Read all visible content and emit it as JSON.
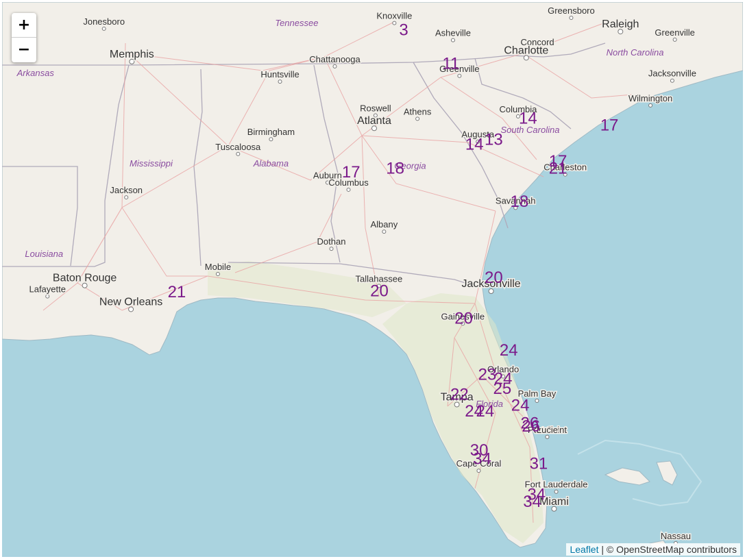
{
  "map": {
    "zoom_in_label": "+",
    "zoom_out_label": "−",
    "attribution": {
      "link_text": "Leaflet",
      "separator": " | © ",
      "text": "OpenStreetMap contributors"
    },
    "colors": {
      "water": "#aad3df",
      "land": "#f2efe9",
      "green_land": "#dfe8c9",
      "state_border": "#b0aaba",
      "road": "#e9a2a2",
      "marker_text": "#7b1a8a",
      "state_label": "#8a4ca0"
    },
    "cities": [
      {
        "name": "Jonesboro",
        "lat": 35.84,
        "lon": -90.7,
        "size": "small"
      },
      {
        "name": "Memphis",
        "lat": 35.15,
        "lon": -90.05,
        "size": "large"
      },
      {
        "name": "Knoxville",
        "lat": 35.96,
        "lon": -83.92,
        "size": "small"
      },
      {
        "name": "Greensboro",
        "lat": 36.07,
        "lon": -79.79,
        "size": "small"
      },
      {
        "name": "Raleigh",
        "lat": 35.78,
        "lon": -78.64,
        "size": "large"
      },
      {
        "name": "Asheville",
        "lat": 35.6,
        "lon": -82.55,
        "size": "small"
      },
      {
        "name": "Concord",
        "lat": 35.41,
        "lon": -80.58,
        "size": "small"
      },
      {
        "name": "Greenville",
        "lat": 35.61,
        "lon": -77.37,
        "size": "small"
      },
      {
        "name": "Chattanooga",
        "lat": 35.05,
        "lon": -85.31,
        "size": "small"
      },
      {
        "name": "Charlotte",
        "lat": 35.23,
        "lon": -80.84,
        "size": "large"
      },
      {
        "name": "Greenville",
        "lat": 34.85,
        "lon": -82.4,
        "size": "small"
      },
      {
        "name": "Huntsville",
        "lat": 34.73,
        "lon": -86.59,
        "size": "small"
      },
      {
        "name": "Jacksonville",
        "lat": 34.75,
        "lon": -77.43,
        "size": "small"
      },
      {
        "name": "Wilmington",
        "lat": 34.23,
        "lon": -77.94,
        "size": "small"
      },
      {
        "name": "Roswell",
        "lat": 34.02,
        "lon": -84.36,
        "size": "small"
      },
      {
        "name": "Athens",
        "lat": 33.95,
        "lon": -83.38,
        "size": "small"
      },
      {
        "name": "Columbia",
        "lat": 34.0,
        "lon": -81.03,
        "size": "small"
      },
      {
        "name": "Birmingham",
        "lat": 33.52,
        "lon": -86.8,
        "size": "small"
      },
      {
        "name": "Atlanta",
        "lat": 33.75,
        "lon": -84.39,
        "size": "large"
      },
      {
        "name": "Augusta",
        "lat": 33.47,
        "lon": -81.97,
        "size": "small"
      },
      {
        "name": "Tuscaloosa",
        "lat": 33.21,
        "lon": -87.57,
        "size": "small"
      },
      {
        "name": "Charleston",
        "lat": 32.78,
        "lon": -79.93,
        "size": "small"
      },
      {
        "name": "Auburn",
        "lat": 32.61,
        "lon": -85.48,
        "size": "small"
      },
      {
        "name": "Columbus",
        "lat": 32.46,
        "lon": -84.99,
        "size": "small"
      },
      {
        "name": "Jackson",
        "lat": 32.3,
        "lon": -90.18,
        "size": "small"
      },
      {
        "name": "Savannah",
        "lat": 32.08,
        "lon": -81.09,
        "size": "small"
      },
      {
        "name": "Albany",
        "lat": 31.58,
        "lon": -84.16,
        "size": "small"
      },
      {
        "name": "Dothan",
        "lat": 31.22,
        "lon": -85.39,
        "size": "small"
      },
      {
        "name": "Mobile",
        "lat": 30.69,
        "lon": -88.04,
        "size": "small"
      },
      {
        "name": "Baton Rouge",
        "lat": 30.45,
        "lon": -91.15,
        "size": "large"
      },
      {
        "name": "Tallahassee",
        "lat": 30.44,
        "lon": -84.28,
        "size": "small"
      },
      {
        "name": "Lafayette",
        "lat": 30.22,
        "lon": -92.02,
        "size": "small"
      },
      {
        "name": "New Orleans",
        "lat": 29.95,
        "lon": -90.07,
        "size": "large"
      },
      {
        "name": "Jacksonville",
        "lat": 30.33,
        "lon": -81.66,
        "size": "large"
      },
      {
        "name": "Gainesville",
        "lat": 29.65,
        "lon": -82.32,
        "size": "small"
      },
      {
        "name": "Orlando",
        "lat": 28.54,
        "lon": -81.38,
        "size": "small"
      },
      {
        "name": "Tampa",
        "lat": 27.95,
        "lon": -82.46,
        "size": "large"
      },
      {
        "name": "Palm Bay",
        "lat": 28.03,
        "lon": -80.59,
        "size": "small"
      },
      {
        "name": "Port Saint",
        "lat": 27.27,
        "lon": -80.35,
        "size": "small"
      },
      {
        "name": "Lucie",
        "lat": 27.27,
        "lon": -80.35,
        "size": "small"
      },
      {
        "name": "Cape Coral",
        "lat": 26.56,
        "lon": -81.95,
        "size": "small"
      },
      {
        "name": "Fort Lauderdale",
        "lat": 26.12,
        "lon": -80.14,
        "size": "small"
      },
      {
        "name": "Miami",
        "lat": 25.76,
        "lon": -80.19,
        "size": "large"
      },
      {
        "name": "Nassau",
        "lat": 25.04,
        "lon": -77.35,
        "size": "small"
      }
    ],
    "state_labels": [
      {
        "name": "Tennessee",
        "lat": 35.9,
        "lon": -86.2
      },
      {
        "name": "North Carolina",
        "lat": 35.28,
        "lon": -78.3
      },
      {
        "name": "Arkansas",
        "lat": 34.85,
        "lon": -92.3
      },
      {
        "name": "South Carolina",
        "lat": 33.65,
        "lon": -80.75
      },
      {
        "name": "Mississippi",
        "lat": 32.95,
        "lon": -89.6
      },
      {
        "name": "Alabama",
        "lat": 32.95,
        "lon": -86.8
      },
      {
        "name": "Georgia",
        "lat": 32.9,
        "lon": -83.55
      },
      {
        "name": "Louisiana",
        "lat": 31.05,
        "lon": -92.1
      },
      {
        "name": "Florida",
        "lat": 27.9,
        "lon": -81.7
      }
    ],
    "markers": [
      {
        "value": "3",
        "lat": 35.7,
        "lon": -83.7
      },
      {
        "value": "11",
        "lat": 35.0,
        "lon": -82.6
      },
      {
        "value": "14",
        "lat": 33.85,
        "lon": -80.8
      },
      {
        "value": "13",
        "lat": 33.4,
        "lon": -81.6
      },
      {
        "value": "14",
        "lat": 33.3,
        "lon": -82.05
      },
      {
        "value": "17",
        "lat": 33.7,
        "lon": -78.9
      },
      {
        "value": "17",
        "lat": 32.95,
        "lon": -80.1
      },
      {
        "value": "21",
        "lat": 32.8,
        "lon": -80.1
      },
      {
        "value": "17",
        "lat": 32.72,
        "lon": -84.93
      },
      {
        "value": "18",
        "lat": 32.8,
        "lon": -83.9
      },
      {
        "value": "18",
        "lat": 32.1,
        "lon": -81.0
      },
      {
        "value": "21",
        "lat": 30.2,
        "lon": -89.0
      },
      {
        "value": "20",
        "lat": 30.22,
        "lon": -84.27
      },
      {
        "value": "20",
        "lat": 30.5,
        "lon": -81.6
      },
      {
        "value": "20",
        "lat": 29.65,
        "lon": -82.3
      },
      {
        "value": "24",
        "lat": 28.98,
        "lon": -81.25
      },
      {
        "value": "23",
        "lat": 28.47,
        "lon": -81.75
      },
      {
        "value": "24",
        "lat": 28.38,
        "lon": -81.38
      },
      {
        "value": "25",
        "lat": 28.17,
        "lon": -81.4
      },
      {
        "value": "22",
        "lat": 28.05,
        "lon": -82.4
      },
      {
        "value": "24",
        "lat": 27.82,
        "lon": -80.98
      },
      {
        "value": "24",
        "lat": 27.7,
        "lon": -82.06
      },
      {
        "value": "24",
        "lat": 27.7,
        "lon": -81.8
      },
      {
        "value": "26",
        "lat": 27.45,
        "lon": -80.76
      },
      {
        "value": "26",
        "lat": 27.38,
        "lon": -80.73
      },
      {
        "value": "30",
        "lat": 26.88,
        "lon": -81.94
      },
      {
        "value": "34",
        "lat": 26.7,
        "lon": -81.87
      },
      {
        "value": "31",
        "lat": 26.6,
        "lon": -80.55
      },
      {
        "value": "34",
        "lat": 25.95,
        "lon": -80.6
      },
      {
        "value": "34",
        "lat": 25.8,
        "lon": -80.7
      }
    ]
  }
}
